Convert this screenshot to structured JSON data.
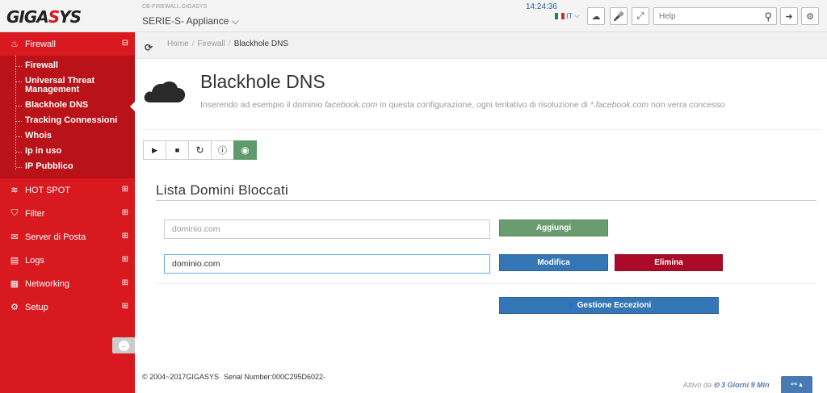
{
  "brand": {
    "logo_prefix": "GIGA",
    "logo_accent": "S",
    "logo_suffix": "YS"
  },
  "device": {
    "name_small": "CB-FIREWALL.GIGASYS",
    "selected": "SERIE-S- Appliance",
    "chevron": "⌵"
  },
  "header": {
    "clock": "14:24:36",
    "language": "IT",
    "lang_chevron": "⌵",
    "search": {
      "placeholder": "Help",
      "value": ""
    },
    "icons": {
      "cloud": "☁",
      "microphone": "🎤",
      "fullscreen": "⤢",
      "search": "⚲",
      "logout": "➜",
      "settings": "⚙"
    },
    "flag_colors": [
      "#009246",
      "#ffffff",
      "#ce2b37"
    ]
  },
  "sidebar": {
    "groups": [
      {
        "label": "Firewall",
        "icon": "♨",
        "toggle": "⊟",
        "expanded": true,
        "items": [
          {
            "label": "Firewall"
          },
          {
            "label": "Universal Threat Management"
          },
          {
            "label": "Blackhole DNS",
            "active": true
          },
          {
            "label": "Tracking Connessioni"
          },
          {
            "label": "Whois"
          },
          {
            "label": "Ip in uso"
          },
          {
            "label": "IP Pubblico"
          }
        ]
      },
      {
        "label": "HOT SPOT",
        "icon": "≋",
        "toggle": "⊞"
      },
      {
        "label": "Filter",
        "icon": "⛉",
        "toggle": "⊞"
      },
      {
        "label": "Server di Posta",
        "icon": "✉",
        "toggle": "⊞"
      },
      {
        "label": "Logs",
        "icon": "▤",
        "toggle": "⊞"
      },
      {
        "label": "Networking",
        "icon": "▦",
        "toggle": "⊞"
      },
      {
        "label": "Setup",
        "icon": "⚙",
        "toggle": "⊞"
      }
    ],
    "collapse_icon": "←"
  },
  "breadcrumb": {
    "refresh_icon": "⟳",
    "items": [
      "Home",
      "Firewall"
    ],
    "separator": "/",
    "current": "Blackhole DNS"
  },
  "page": {
    "title": "Blackhole DNS",
    "desc_1": "Inserendo ad esempio il dominio ",
    "desc_domain": "facebook.com",
    "desc_2": " in questa configurazione, ogni tentativo di risoluzione di ",
    "desc_wild": "*.facebook.com",
    "desc_3": " non verra concesso"
  },
  "service_toolbar": {
    "play": "▶",
    "stop": "■",
    "restart": "↻",
    "info": "ⓘ",
    "status": "◉"
  },
  "section": {
    "title": "Lista Domini Bloccati",
    "add_input": {
      "placeholder": "dominio.com",
      "value": ""
    },
    "edit_input": {
      "placeholder": "dominio.com",
      "value": "dominio.com"
    },
    "add_button": "Aggiungi",
    "edit_button": "Modifica",
    "delete_button": "Elimina",
    "exceptions_icon": "👤",
    "exceptions_button": "Gestione Eccezioni"
  },
  "footer": {
    "copyright": "© 2004~2017GIGASYS",
    "serial": "Serial Number:000C295D6022-",
    "uptime_label": "Attivo da ",
    "uptime_icon": "⏲",
    "uptime_value": " 3 Giorni 9 Min",
    "btn_icon": "⚯",
    "btn_caret": "▴"
  },
  "colors": {
    "brand_red": "#d8191f",
    "submenu_red": "#b91218",
    "green": "#6b9c6f",
    "blue": "#3476b6",
    "red_button": "#ab0a28"
  }
}
